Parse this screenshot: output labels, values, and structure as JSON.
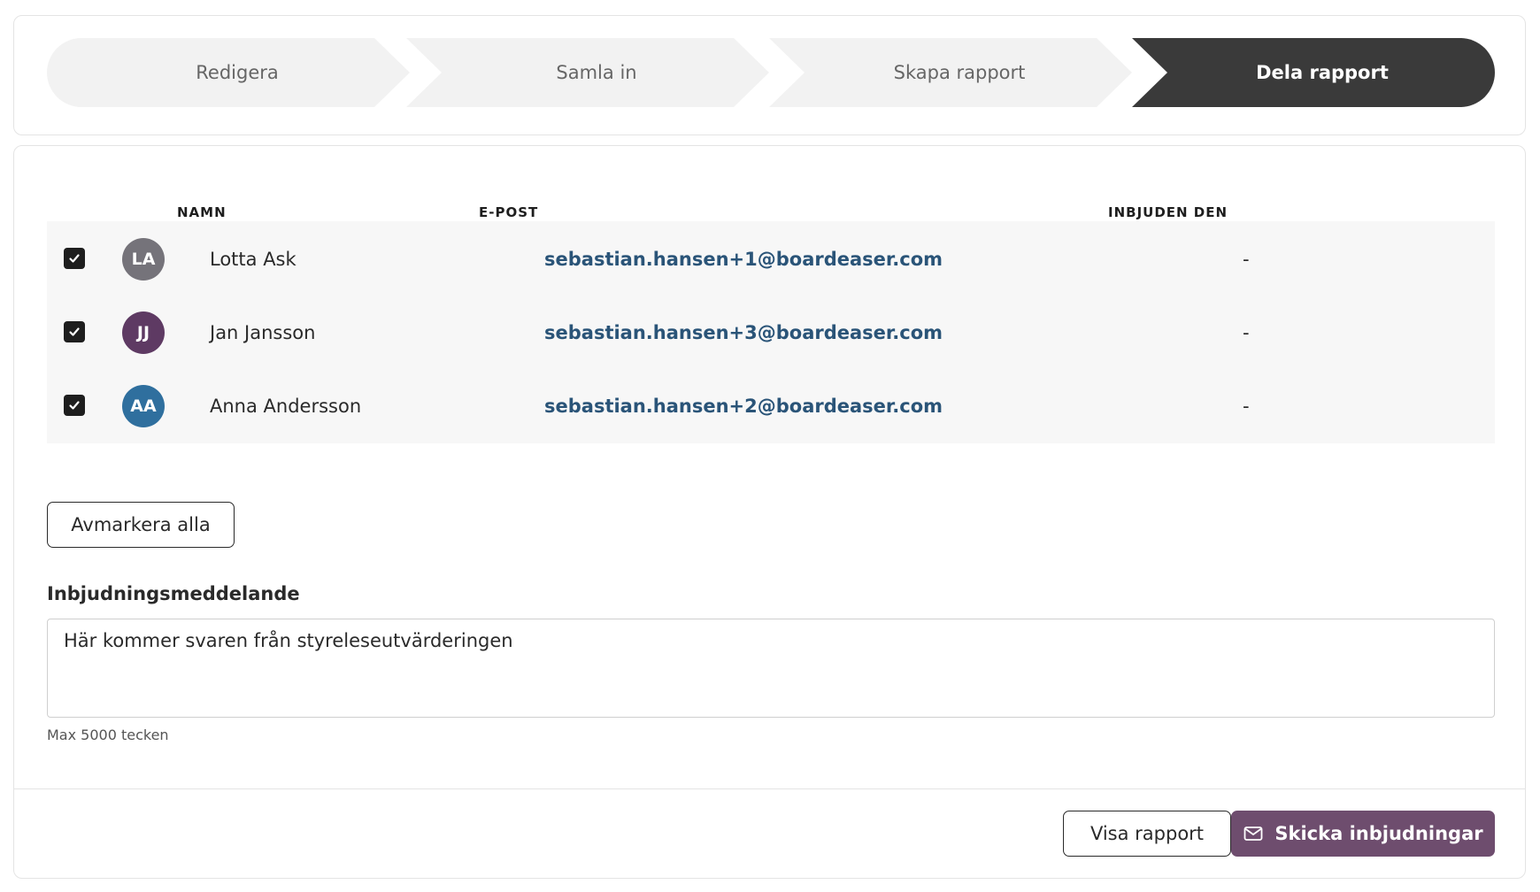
{
  "stepper": {
    "steps": [
      {
        "label": "Redigera",
        "active": false
      },
      {
        "label": "Samla in",
        "active": false
      },
      {
        "label": "Skapa rapport",
        "active": false
      },
      {
        "label": "Dela rapport",
        "active": true
      }
    ]
  },
  "table": {
    "headers": {
      "name": "NAMN",
      "email": "E-POST",
      "invited": "INBJUDEN DEN"
    },
    "rows": [
      {
        "initials": "LA",
        "avatar_color": "#75737a",
        "name": "Lotta Ask",
        "email": "sebastian.hansen+1@boardeaser.com",
        "invited": "-",
        "checked": true
      },
      {
        "initials": "JJ",
        "avatar_color": "#5e3a63",
        "name": "Jan Jansson",
        "email": "sebastian.hansen+3@boardeaser.com",
        "invited": "-",
        "checked": true
      },
      {
        "initials": "AA",
        "avatar_color": "#2f6f9e",
        "name": "Anna Andersson",
        "email": "sebastian.hansen+2@boardeaser.com",
        "invited": "-",
        "checked": true
      }
    ]
  },
  "actions": {
    "deselect_all": "Avmarkera alla",
    "view_report": "Visa rapport",
    "send_invites": "Skicka inbjudningar"
  },
  "message": {
    "label": "Inbjudningsmeddelande",
    "value": "Här kommer svaren från styreleseutvärderingen",
    "hint": "Max 5000 tecken"
  },
  "colors": {
    "primary": "#6e4d6e",
    "active_step": "#3a3a3a",
    "link": "#2a5478"
  }
}
